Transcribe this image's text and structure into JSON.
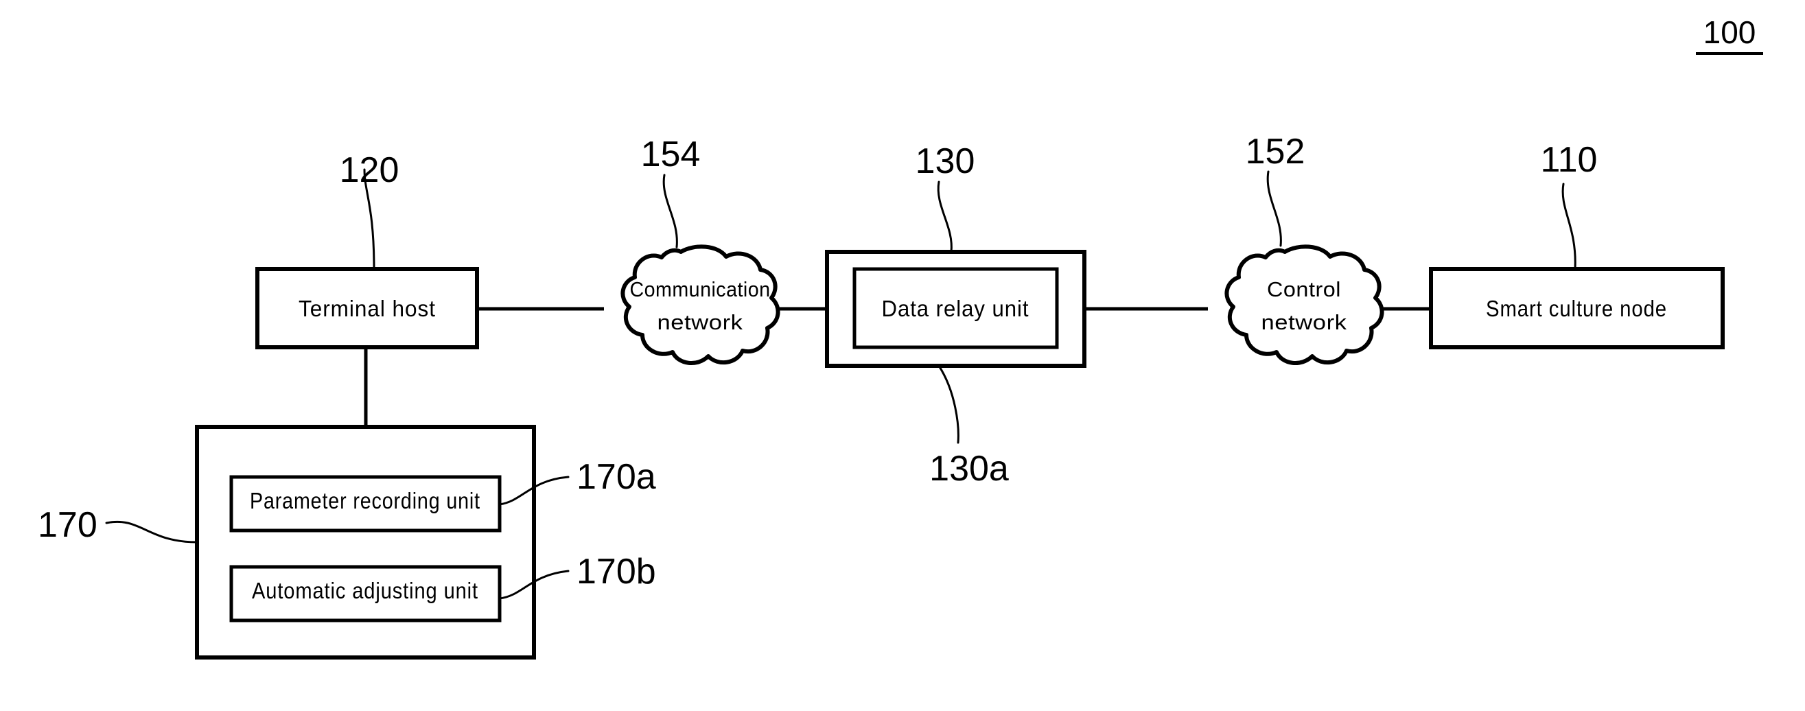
{
  "figure": {
    "number": "100",
    "underlined": true
  },
  "nodes": [
    {
      "id": "terminal-host",
      "label": "Terminal host",
      "ref": "120"
    },
    {
      "id": "communication-network",
      "label_line1": "Communication",
      "label_line2": "network",
      "ref": "154"
    },
    {
      "id": "data-relay-unit",
      "label": "Data relay unit",
      "ref_outer": "130",
      "ref_inner": "130a"
    },
    {
      "id": "control-network",
      "label_line1": "Control",
      "label_line2": "network",
      "ref": "152"
    },
    {
      "id": "smart-culture-node",
      "label": "Smart culture node",
      "ref": "110"
    },
    {
      "id": "parameter-recording-unit",
      "label": "Parameter recording unit",
      "ref": "170a"
    },
    {
      "id": "automatic-adjusting-unit",
      "label": "Automatic adjusting unit",
      "ref": "170b"
    },
    {
      "id": "unit-group",
      "label": "",
      "ref": "170"
    }
  ],
  "colors": {
    "stroke": "#000000",
    "background": "#ffffff",
    "text": "#000000"
  }
}
